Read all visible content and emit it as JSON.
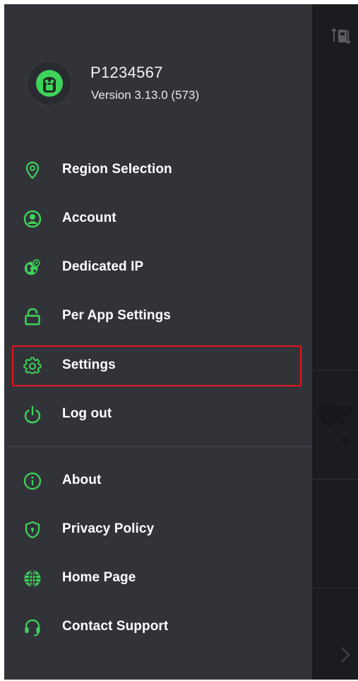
{
  "user": {
    "username": "P1234567",
    "version": "Version 3.13.0 (573)"
  },
  "menu_primary": [
    {
      "label": "Region Selection",
      "icon": "map-pin-icon"
    },
    {
      "label": "Account",
      "icon": "account-circle-icon"
    },
    {
      "label": "Dedicated IP",
      "icon": "globe-pin-icon"
    },
    {
      "label": "Per App Settings",
      "icon": "lock-icon"
    },
    {
      "label": "Settings",
      "icon": "gear-icon"
    },
    {
      "label": "Log out",
      "icon": "power-icon"
    }
  ],
  "menu_secondary": [
    {
      "label": "About",
      "icon": "info-icon"
    },
    {
      "label": "Privacy Policy",
      "icon": "shield-icon"
    },
    {
      "label": "Home Page",
      "icon": "globe-icon"
    },
    {
      "label": "Contact Support",
      "icon": "headset-icon"
    }
  ],
  "colors": {
    "accent": "#3ed35a",
    "drawer_bg": "#323339",
    "highlight": "#e3141c"
  }
}
